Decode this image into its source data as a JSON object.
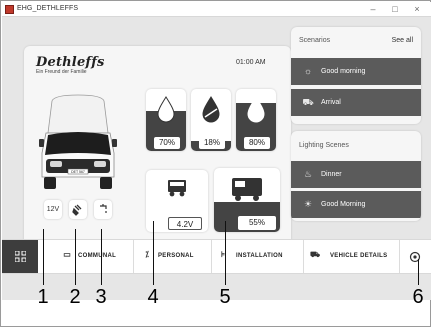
{
  "window": {
    "title": "EHG_DETHLEFFS",
    "min_glyph": "–",
    "max_glyph": "□",
    "close_glyph": "×"
  },
  "brand": {
    "name": "Dethleffs",
    "tagline": "Ein Freund der Familie"
  },
  "clock": "01:00 AM",
  "vehicle": {
    "plate": "DET 567"
  },
  "tanks": [
    {
      "id": "fresh-water",
      "icon": "water-drop-icon",
      "level_percent": 70,
      "label": "70%"
    },
    {
      "id": "grey-water",
      "icon": "grey-water-drop-icon",
      "level_percent": 18,
      "label": "18%"
    },
    {
      "id": "waste-water",
      "icon": "black-water-drop-icon",
      "level_percent": 80,
      "label": "80%"
    }
  ],
  "batteries": [
    {
      "id": "vehicle-battery",
      "icon": "vehicle-battery-icon",
      "label": "4.2V"
    },
    {
      "id": "living-battery",
      "icon": "living-battery-icon",
      "label": "55%"
    }
  ],
  "quick_buttons": [
    {
      "id": "12v",
      "label": "12V"
    },
    {
      "id": "power-plug",
      "icon": "power-plug-icon"
    },
    {
      "id": "water-pump",
      "icon": "water-tap-icon"
    }
  ],
  "scenarios": {
    "title": "Scenarios",
    "see_all": "See all",
    "items": [
      {
        "icon": "sunrise-icon",
        "label": "Good morning"
      },
      {
        "icon": "arrival-icon",
        "label": "Arrival"
      }
    ]
  },
  "lighting": {
    "title": "Lighting Scenes",
    "items": [
      {
        "icon": "dinner-light-icon",
        "label": "Dinner"
      },
      {
        "icon": "morning-light-icon",
        "label": "Good Morning"
      }
    ]
  },
  "nav": {
    "items": [
      {
        "icon": "communal-icon",
        "label": "COMMUNAL"
      },
      {
        "icon": "personal-icon",
        "label": "PERSONAL"
      },
      {
        "icon": "installation-icon",
        "label": "INSTALLATION"
      },
      {
        "icon": "vehicle-details-icon",
        "label": "VEHICLE DETAILS"
      }
    ]
  },
  "callouts": [
    "1",
    "2",
    "3",
    "4",
    "5",
    "6"
  ],
  "colors": {
    "fill_dark": "#444444",
    "row_bg": "#5b5b5b",
    "home_bg": "#3d3d3d"
  }
}
